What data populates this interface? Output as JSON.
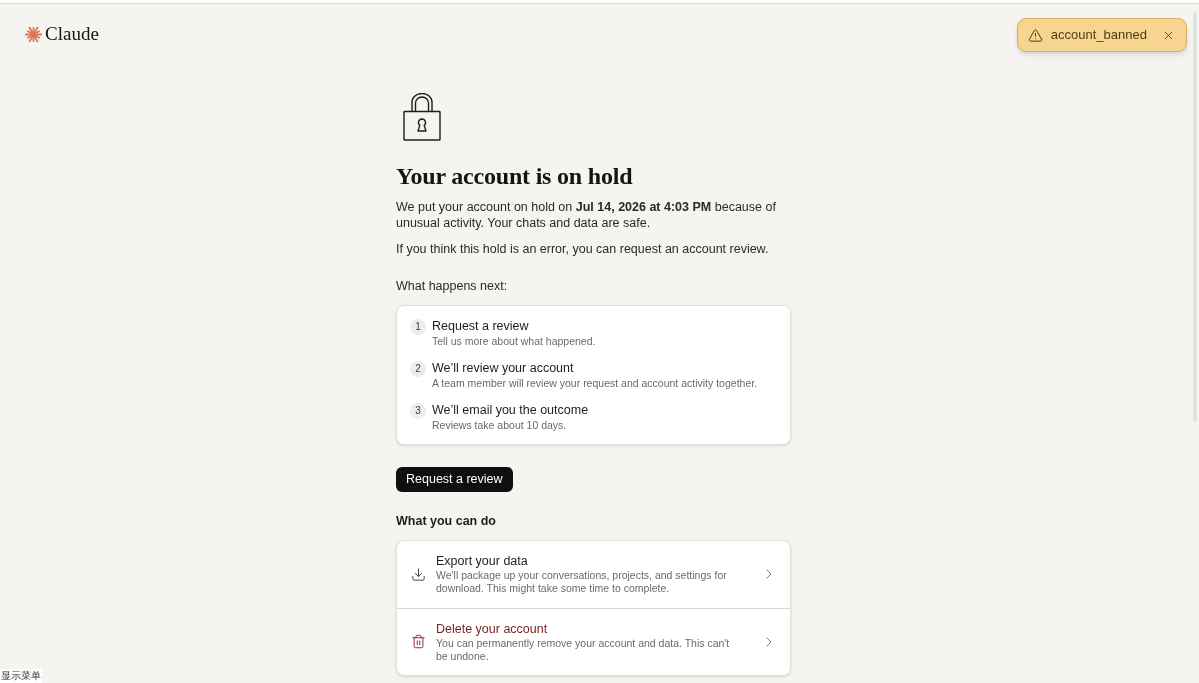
{
  "header": {
    "logo": "Claude"
  },
  "toast": {
    "kind": "warning",
    "text": "account_banned"
  },
  "hold": {
    "title": "Your account is on hold",
    "message": "We put your account on hold on **Jul 14, 2026 at 4:03 PM** because of unusual activity. Your chats and data are safe.",
    "note": "If you think this hold is an error, you can request an account review."
  },
  "next_steps": {
    "heading": "What happens next:",
    "steps": [
      {
        "number": "1",
        "title": "Request a review",
        "description": "Tell us more about what happened."
      },
      {
        "number": "2",
        "title": "We’ll review your account",
        "description": "A team member will review your request and account activity together."
      },
      {
        "number": "3",
        "title": "We’ll email you the outcome",
        "description": "Reviews take about 10 days."
      }
    ]
  },
  "primary_button": "Request a review",
  "actions": {
    "heading": "What you can do",
    "items": [
      {
        "kind": "export",
        "title": "Export your data",
        "description": "We'll package up your conversations, projects, and settings for download. This might take some time to complete."
      },
      {
        "kind": "delete",
        "title": "Delete your account",
        "description": "You can permanently remove your account and data. This can't be undone."
      }
    ]
  },
  "tooltip": "显示菜单"
}
